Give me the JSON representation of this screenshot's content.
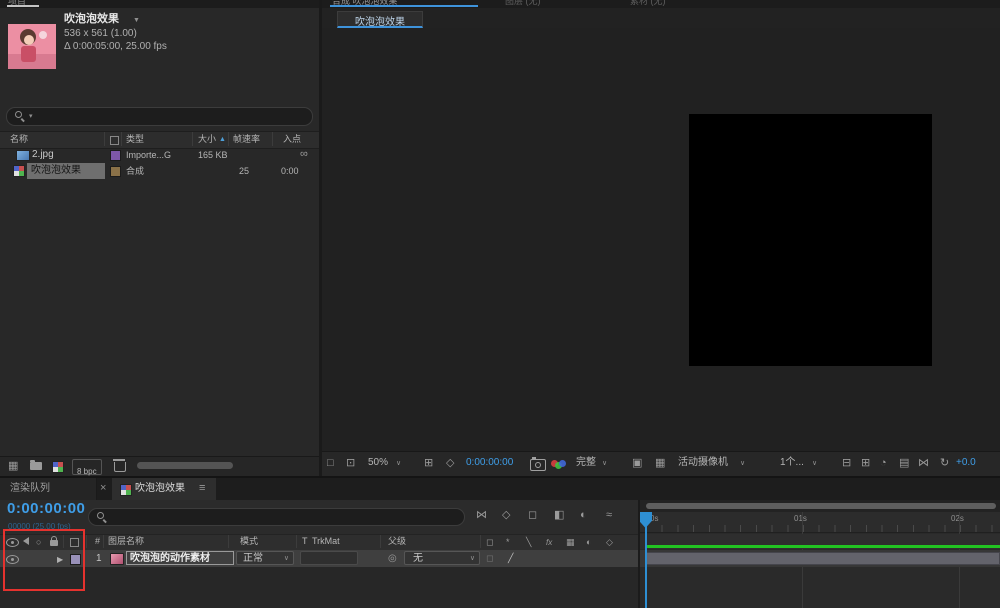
{
  "colors": {
    "accent_blue": "#3E93DB",
    "time_blue": "#3F9EE8",
    "cti_blue": "#2E8FD3",
    "render_bar_green": "#22C322",
    "annotation_red": "#E5322E",
    "label_purple": "#7E57A8",
    "label_tan": "#8A7148"
  },
  "top_tabs": {
    "project_tab": "项目",
    "composition_tab": "合成 吹泡泡效果",
    "layer_tab": "图层 (无)",
    "footage_tab": "素材 (无)"
  },
  "project_panel": {
    "selected_item": {
      "name": "吹泡泡效果",
      "dimensions": "536 x 561 (1.00)",
      "duration_info": "Δ 0:00:05:00, 25.00 fps"
    },
    "search_value": "",
    "columns": {
      "name": "名称",
      "type": "类型",
      "size": "大小",
      "frame_rate": "帧速率",
      "in_point": "入点"
    },
    "items": [
      {
        "name": "2.jpg",
        "type": "Importe...G",
        "size": "165 KB",
        "frame_rate": "",
        "in_point": "",
        "label_color": "#7E57A8"
      },
      {
        "name": "吹泡泡效果",
        "type": "合成",
        "size": "",
        "frame_rate": "25",
        "in_point": "0:00",
        "label_color": "#8A7148"
      }
    ],
    "footer": {
      "bit_depth": "8 bpc"
    }
  },
  "viewer_panel": {
    "viewer_tab": "吹泡泡效果",
    "toolbar": {
      "zoom": "50%",
      "time": "0:00:00:00",
      "resolution": "完整",
      "camera": "活动摄像机",
      "view_layout": "1个...",
      "exposure": "+0.0"
    }
  },
  "timeline_panel": {
    "render_queue_tab": "渲染队列",
    "comp_tab": "吹泡泡效果",
    "current_time": "0:00:00:00",
    "frames_readout": "00000 (25.00 fps)",
    "search_value": "",
    "columns": {
      "index": "#",
      "layer_name": "图层名称",
      "mode": "模式",
      "t": "T",
      "trkmat": "TrkMat",
      "parent": "父级"
    },
    "layers": [
      {
        "index": "1",
        "name": "吹泡泡的动作素材",
        "mode": "正常",
        "parent": "无"
      }
    ],
    "ruler": {
      "labels": [
        "0s",
        "01s",
        "02s"
      ]
    }
  }
}
